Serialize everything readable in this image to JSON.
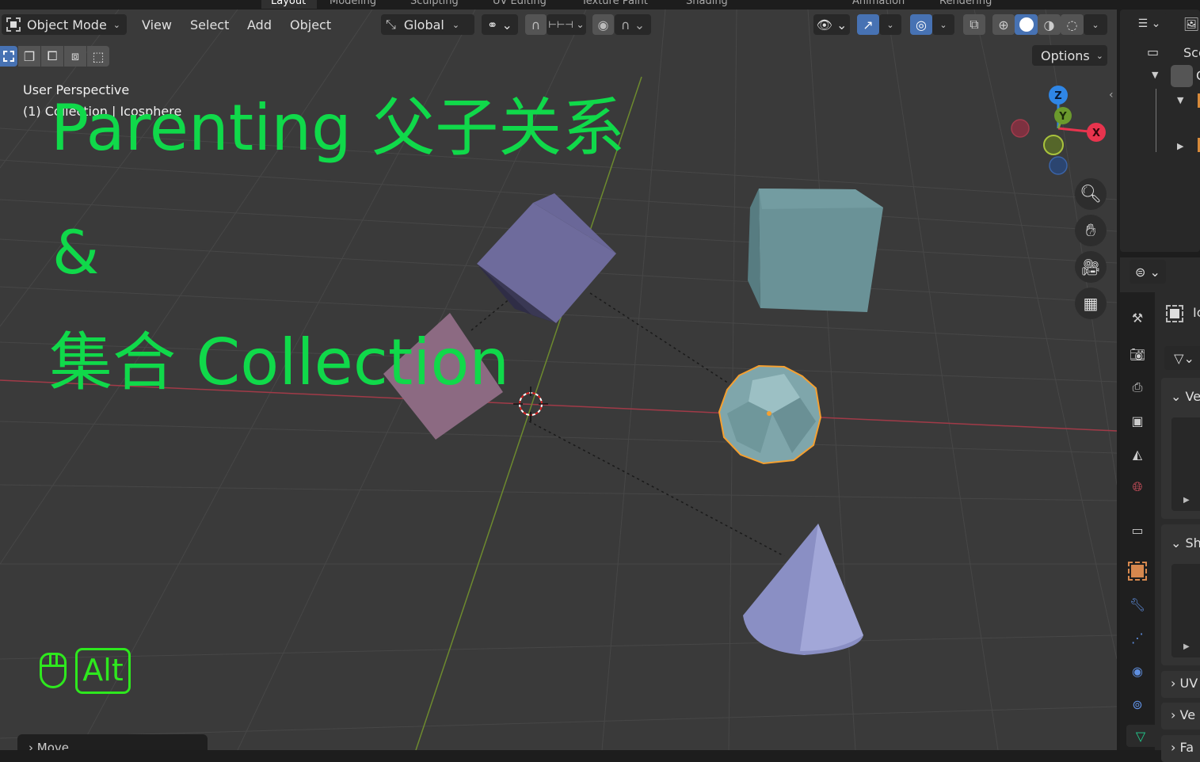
{
  "workspace_tabs": [
    "Layout",
    "Modeling",
    "Sculpting",
    "UV Editing",
    "Texture Paint",
    "Shading",
    "Animation",
    "Rendering"
  ],
  "active_tab": "Layout",
  "header": {
    "mode": "Object Mode",
    "menus": [
      "View",
      "Select",
      "Add",
      "Object"
    ],
    "transform_orientation": "Global",
    "options_label": "Options"
  },
  "viewport": {
    "view_name": "User Perspective",
    "collection_info": "(1) Collection | Icosphere",
    "gizmo_axes": {
      "x": "X",
      "y": "Y",
      "z": "Z"
    },
    "nav_buttons": [
      "zoom",
      "pan",
      "camera",
      "ortho-grid"
    ]
  },
  "overlay_title": {
    "line1": "Parenting 父子关系",
    "line2": "&",
    "line3": "集合 Collection"
  },
  "key_hint": {
    "mouse": "mouse-icon",
    "key": "Alt"
  },
  "last_operator": "Move",
  "outliner": {
    "scene_label": "Scer",
    "collection_label": "C"
  },
  "properties": {
    "object_label": "Ic",
    "panels": [
      {
        "label": "Ve",
        "expanded": true
      },
      {
        "label": "Sh",
        "expanded": true
      },
      {
        "label": "UV",
        "expanded": false
      },
      {
        "label": "Ve",
        "expanded": false
      },
      {
        "label": "Fa",
        "expanded": false
      }
    ],
    "tabs": [
      "tool",
      "render",
      "output",
      "view-layer",
      "scene",
      "world",
      "collection",
      "object",
      "modifiers",
      "particles",
      "physics",
      "constraints",
      "data"
    ],
    "active_tab": "data"
  },
  "colors": {
    "accent_blue": "#4772b3",
    "overlay_green": "#10d94a",
    "selection_orange": "#f5a030",
    "axis_x": "#e8344e",
    "axis_y": "#7ea33a",
    "axis_z": "#2f86e6"
  }
}
